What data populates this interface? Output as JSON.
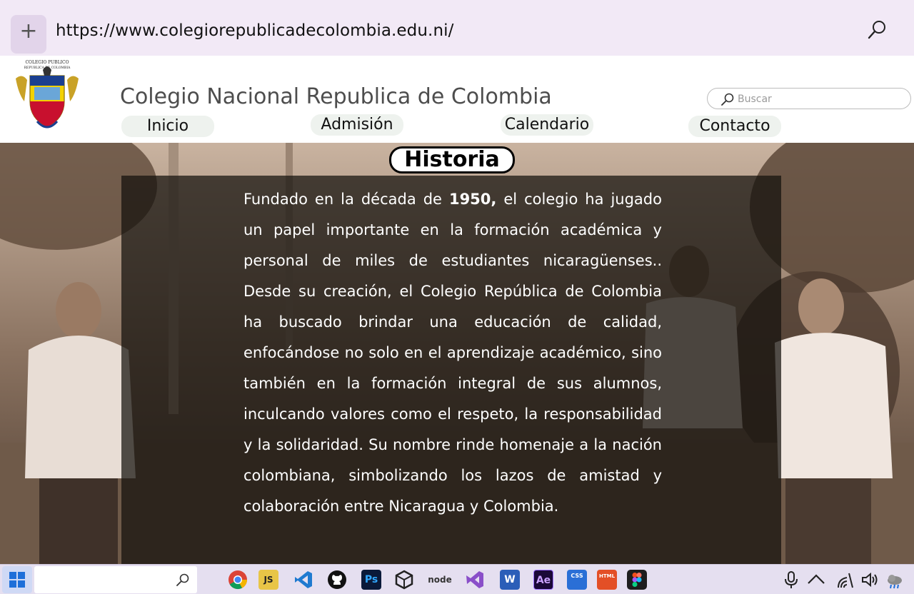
{
  "browser": {
    "url": "https://www.colegiorepublicadecolombia.edu.ni/",
    "new_tab_label": "+"
  },
  "site": {
    "title": "Colegio Nacional Republica de Colombia",
    "crest_text_top": "COLEGIO PUBLICO",
    "crest_text_bottom": "REPUBLICA DE COLOMBIA",
    "search_placeholder": "Buscar",
    "nav": [
      {
        "label": "Inicio"
      },
      {
        "label": "Admisión"
      },
      {
        "label": "Calendario"
      },
      {
        "label": "Contacto"
      }
    ]
  },
  "history": {
    "badge": "Historia",
    "text_before": "Fundado en la década de ",
    "text_bold": "1950,",
    "text_after": " el colegio ha jugado un papel importante en la formación académica y personal de miles de estudiantes nicaragüenses.. Desde su creación, el Colegio República de Colombia ha buscado brindar una educación de calidad, enfocándose no solo en el aprendizaje académico, sino también en la formación integral de sus alumnos, inculcando valores como el respeto, la responsabilidad y la solidaridad. Su nombre rinde homenaje a la nación colombiana, simbolizando los lazos de amistad y colaboración entre Nicaragua y Colombia."
  },
  "taskbar": {
    "apps": [
      "chrome-icon",
      "javascript-icon",
      "vscode-icon",
      "github-icon",
      "photoshop-icon",
      "unity-icon",
      "nodejs-icon",
      "visual-studio-icon",
      "word-icon",
      "after-effects-icon",
      "css3-icon",
      "html5-icon",
      "figma-icon"
    ],
    "app_labels": {
      "js": "JS",
      "ps": "Ps",
      "node": "node",
      "word": "W",
      "ae": "Ae",
      "css": "CSS",
      "html": "HTML"
    },
    "tray": [
      "microphone-icon",
      "chevron-up-icon",
      "wifi-icon",
      "volume-icon",
      "weather-icon"
    ]
  },
  "colors": {
    "browser_bar": "#f2e9f6",
    "overlay": "#14100c",
    "accent_blue": "#1e6fd9"
  }
}
